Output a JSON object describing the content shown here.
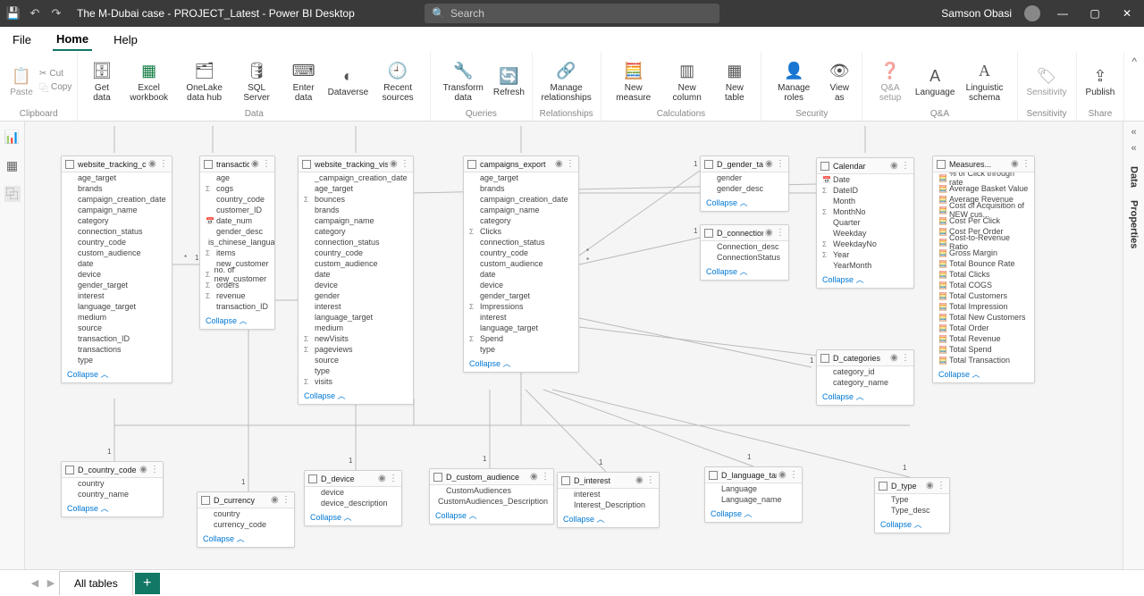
{
  "app": {
    "title": "The M-Dubai case - PROJECT_Latest - Power BI Desktop",
    "search_placeholder": "Search",
    "user": "Samson Obasi"
  },
  "tabs": {
    "file": "File",
    "home": "Home",
    "help": "Help"
  },
  "ribbon": {
    "clipboard": {
      "label": "Clipboard",
      "paste": "Paste",
      "cut": "Cut",
      "copy": "Copy"
    },
    "data": {
      "label": "Data",
      "get": "Get data",
      "excel": "Excel workbook",
      "onelake": "OneLake data hub",
      "sql": "SQL Server",
      "enter": "Enter data",
      "dataverse": "Dataverse",
      "recent": "Recent sources"
    },
    "queries": {
      "label": "Queries",
      "transform": "Transform data",
      "refresh": "Refresh"
    },
    "relationships": {
      "label": "Relationships",
      "manage": "Manage relationships"
    },
    "calculations": {
      "label": "Calculations",
      "measure": "New measure",
      "column": "New column",
      "table": "New table"
    },
    "security": {
      "label": "Security",
      "roles": "Manage roles",
      "view": "View as"
    },
    "qa": {
      "label": "Q&A",
      "setup": "Q&A setup",
      "lang": "Language",
      "schema": "Linguistic schema"
    },
    "sensitivity": {
      "label": "Sensitivity",
      "btn": "Sensitivity"
    },
    "share": {
      "label": "Share",
      "publish": "Publish"
    }
  },
  "collapse_label": "Collapse",
  "tables": {
    "website_tracking_checkout": {
      "name": "website_tracking_checkout",
      "fields": [
        "age_target",
        "brands",
        "campaign_creation_date",
        "campaign_name",
        "category",
        "connection_status",
        "country_code",
        "custom_audience",
        "date",
        "device",
        "gender_target",
        "interest",
        "language_target",
        "medium",
        "source",
        "transaction_ID",
        "transactions",
        "type"
      ]
    },
    "transactions": {
      "name": "transactions",
      "fields": [
        "age",
        "cogs",
        "country_code",
        "customer_ID",
        "date_num",
        "gender_desc",
        "is_chinese_language",
        "items",
        "new_customer",
        "no. of new_customer",
        "orders",
        "revenue",
        "transaction_ID"
      ]
    },
    "website_tracking_visits": {
      "name": "website_tracking_visits",
      "fields": [
        "_campaign_creation_date",
        "age_target",
        "bounces",
        "brands",
        "campaign_name",
        "category",
        "connection_status",
        "country_code",
        "custom_audience",
        "date",
        "device",
        "gender",
        "interest",
        "language_target",
        "medium",
        "newVisits",
        "pageviews",
        "source",
        "type",
        "visits"
      ]
    },
    "campaigns_export": {
      "name": "campaigns_export",
      "fields": [
        "age_target",
        "brands",
        "campaign_creation_date",
        "campaign_name",
        "category",
        "Clicks",
        "connection_status",
        "country_code",
        "custom_audience",
        "date",
        "device",
        "gender_target",
        "Impressions",
        "interest",
        "language_target",
        "Spend",
        "type"
      ]
    },
    "d_gender_target": {
      "name": "D_gender_target",
      "fields": [
        "gender",
        "gender_desc"
      ]
    },
    "d_connection_stat": {
      "name": "D_connection_stat...",
      "fields": [
        "Connection_desc",
        "ConnectionStatus"
      ]
    },
    "calendar": {
      "name": "Calendar",
      "fields": [
        "Date",
        "DateID",
        "Month",
        "MonthNo",
        "Quarter",
        "Weekday",
        "WeekdayNo",
        "Year",
        "YearMonth"
      ]
    },
    "d_categories": {
      "name": "D_categories",
      "fields": [
        "category_id",
        "category_name"
      ]
    },
    "measures": {
      "name": "Measures...",
      "fields": [
        "% of Click through rate",
        "Average Basket Value",
        "Average Revenue",
        "Cost of Acquisition of NEW cus...",
        "Cost Per Click",
        "Cost Per Order",
        "Cost-to-Revenue Ratio",
        "Gross Margin",
        "Total Bounce Rate",
        "Total Clicks",
        "Total COGS",
        "Total Customers",
        "Total Impression",
        "Total New Customers",
        "Total Order",
        "Total Revenue",
        "Total Spend",
        "Total Transaction"
      ]
    },
    "d_country_code": {
      "name": "D_country_code",
      "fields": [
        "country",
        "country_name"
      ]
    },
    "d_currency": {
      "name": "D_currency",
      "fields": [
        "country",
        "currency_code"
      ]
    },
    "d_device": {
      "name": "D_device",
      "fields": [
        "device",
        "device_description"
      ]
    },
    "d_custom_audience": {
      "name": "D_custom_audience",
      "fields": [
        "CustomAudiences",
        "CustomAudiences_Description"
      ]
    },
    "d_interest": {
      "name": "D_interest",
      "fields": [
        "interest",
        "Interest_Description"
      ]
    },
    "d_language_target": {
      "name": "D_language_target",
      "fields": [
        "Language",
        "Language_name"
      ]
    },
    "d_type": {
      "name": "D_type",
      "fields": [
        "Type",
        "Type_desc"
      ]
    }
  },
  "bottom": {
    "tab": "All tables"
  },
  "right_panels": {
    "data": "Data",
    "properties": "Properties"
  }
}
